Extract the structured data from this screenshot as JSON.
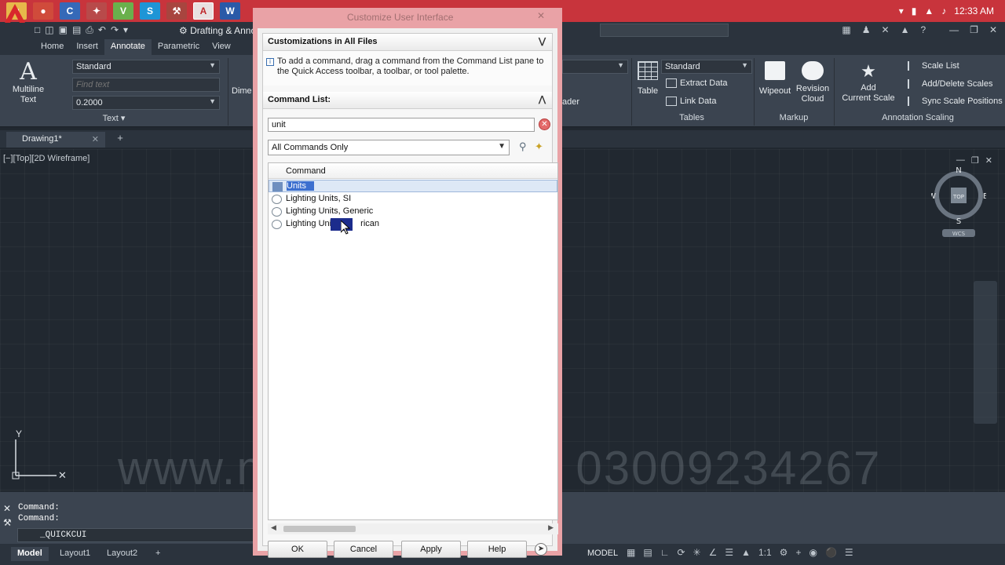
{
  "taskbar": {
    "clock": "12:33 AM",
    "ghost_title": "Customize User Interface"
  },
  "app": {
    "workspace": "Drafting & Annotation",
    "workspace_visible": "Drafting & Anno"
  },
  "ribbon": {
    "tabs": [
      "Home",
      "Insert",
      "Annotate",
      "Parametric",
      "View"
    ],
    "active_tab": "Annotate",
    "text_panel": {
      "multiline_text": "Multiline Text",
      "multiline_text_line1": "Multiline",
      "multiline_text_line2": "Text",
      "style": "Standard",
      "find_placeholder": "Find text",
      "height": "0.2000",
      "footer": "Text"
    },
    "dim_label": "Dime",
    "leader_label": "ader",
    "tables_panel": {
      "style": "Standard",
      "table": "Table",
      "extract_data": "Extract Data",
      "link_data": "Link Data",
      "footer": "Tables"
    },
    "markup_panel": {
      "wipeout": "Wipeout",
      "revision_cloud_line1": "Revision",
      "revision_cloud_line2": "Cloud",
      "footer": "Markup"
    },
    "annotation_scaling_panel": {
      "add_scale_line1": "Add",
      "add_scale_line2": "Current Scale",
      "scale_list": "Scale List",
      "add_delete_scales": "Add/Delete Scales",
      "sync_scale_positions": "Sync Scale Positions",
      "footer": "Annotation Scaling"
    }
  },
  "document": {
    "tab": "Drawing1*",
    "view_label": "[−][Top][2D Wireframe]",
    "viewcube": {
      "n": "N",
      "s": "S",
      "e": "E",
      "w": "W",
      "top": "TOP",
      "wcs": "WCS"
    },
    "ucs_y": "Y",
    "watermark_left": "www.m",
    "watermark_right": "03009234267"
  },
  "command": {
    "history": [
      "Command:",
      "Command:"
    ],
    "input": "_QUICKCUI"
  },
  "status": {
    "layouts": [
      "Model",
      "Layout1",
      "Layout2"
    ],
    "active_layout": "Model",
    "model": "MODEL",
    "scale": "1:1"
  },
  "dialog": {
    "section1": "Customizations in All Files",
    "hint": "To add a command, drag a command from the Command List pane to the Quick Access toolbar, a toolbar, or tool palette.",
    "section2": "Command List:",
    "search_value": "unit",
    "filter": "All Commands Only",
    "column": "Command",
    "commands": [
      "Units",
      "Lighting Units, SI",
      "Lighting Units, Generic",
      "Lighting Units, American"
    ],
    "command_visible_4": "Lighting Unit",
    "command_visible_4_tail": "rican",
    "selected": "Units",
    "buttons": {
      "ok": "OK",
      "cancel": "Cancel",
      "apply": "Apply",
      "help": "Help"
    }
  }
}
